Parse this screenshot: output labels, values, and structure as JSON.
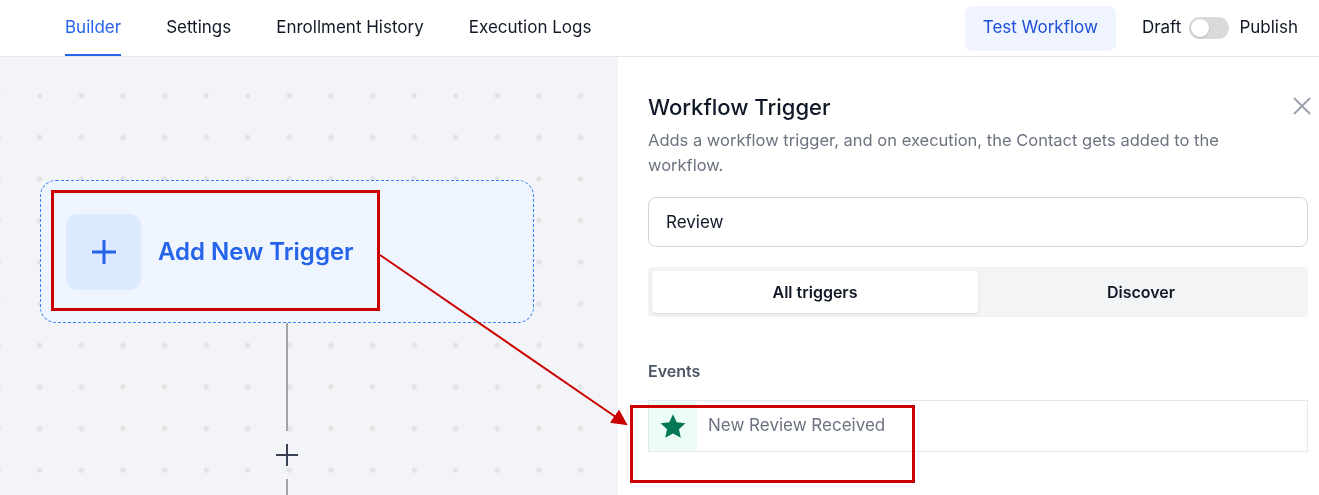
{
  "nav_tabs": [
    {
      "label": "Builder",
      "selected": true
    },
    {
      "label": "Settings",
      "selected": false
    },
    {
      "label": "Enrollment History",
      "selected": false
    },
    {
      "label": "Execution Logs",
      "selected": false
    }
  ],
  "test_button": "Test Workflow",
  "publish_toggle": {
    "off_label": "Draft",
    "on_label": "Publish",
    "on": false
  },
  "canvas": {
    "trigger_node": "Add New Trigger"
  },
  "panel": {
    "title": "Workflow Trigger",
    "description": "Adds a workflow trigger, and on execution, the Contact gets added to the workflow.",
    "search": {
      "value": "Review"
    },
    "segments": [
      {
        "label": "All triggers",
        "selected": true
      },
      {
        "label": "Discover",
        "selected": false
      }
    ],
    "section": "Events",
    "items": [
      {
        "label": "New Review Received"
      }
    ]
  }
}
